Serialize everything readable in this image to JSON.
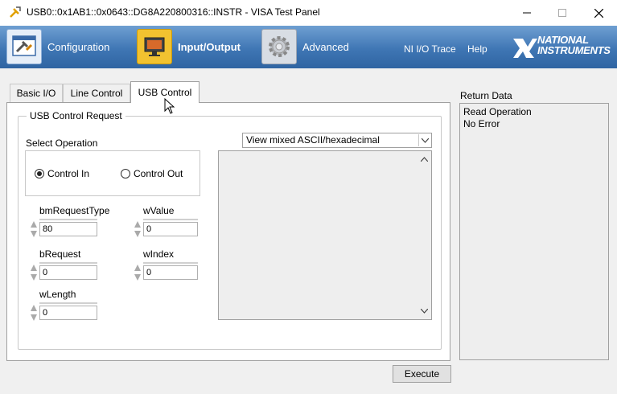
{
  "window": {
    "title": "USB0::0x1AB1::0x0643::DG8A220800316::INSTR - VISA Test Panel"
  },
  "toolbar": {
    "items": [
      {
        "label": "Configuration",
        "icon": "configuration-icon"
      },
      {
        "label": "Input/Output",
        "icon": "monitor-icon"
      },
      {
        "label": "Advanced",
        "icon": "gear-icon"
      }
    ],
    "links": [
      "NI I/O Trace",
      "Help"
    ],
    "brand": "NATIONAL INSTRUMENTS"
  },
  "tabs": [
    "Basic I/O",
    "Line Control",
    "USB Control"
  ],
  "active_tab": "USB Control",
  "usb_control": {
    "group_title": "USB Control Request",
    "select_operation_label": "Select Operation",
    "radio_in": "Control In",
    "radio_out": "Control Out",
    "selected": "Control In",
    "fields": {
      "bmRequestType": {
        "label": "bmRequestType",
        "value": "80"
      },
      "wValue": {
        "label": "wValue",
        "value": "0"
      },
      "bRequest": {
        "label": "bRequest",
        "value": "0"
      },
      "wIndex": {
        "label": "wIndex",
        "value": "0"
      },
      "wLength": {
        "label": "wLength",
        "value": "0"
      }
    },
    "view_mode": "View mixed ASCII/hexadecimal",
    "data_text": ""
  },
  "return_data": {
    "label": "Return Data",
    "lines": [
      "Read Operation",
      "No Error"
    ]
  },
  "execute_label": "Execute",
  "colors": {
    "toolbar": "#3f76b4",
    "panel_bg": "#f0f0f0"
  }
}
